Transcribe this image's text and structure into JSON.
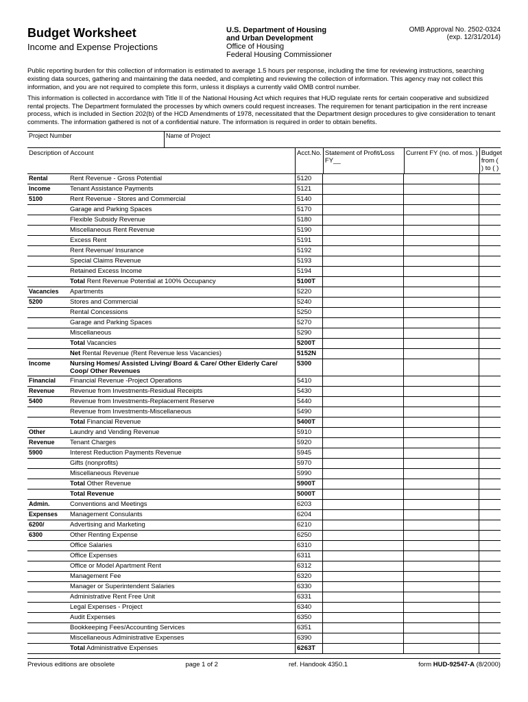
{
  "header": {
    "title": "Budget Worksheet",
    "subtitle": "Income and Expense Projections",
    "dept1": "U.S. Department of Housing",
    "dept2": "and Urban Development",
    "office1": "Office of Housing",
    "office2": "Federal Housing Commissioner",
    "omb1": "OMB Approval No. 2502-0324",
    "omb2": "(exp. 12/31/2014)"
  },
  "para1": "Public reporting burden for this collection of information is estimated to average 1.5 hours per response, including the time for reviewing instructions, searching existing data sources, gathering and maintaining the data needed, and completing and reviewing the collection of information.  This agency may not collect this information, and you are not required to complete this form, unless it displays a currently valid OMB control number.",
  "para2": "This information is collected in accordance with Title II of the National Housing Act which requires that HUD regulate rents for certain cooperative and subsidized rental projects.  The Department formulated the processes by which owners could request increases.  The requiremen for tenant participation in the rent increase process, which is included in Section 202(b) of the HCD Amendments of 1978, necessitated that the Department design procedures to give consideration to tenant comments.  The information gathered is not of a confidential nature.  The information is required in order to obtain benefits.",
  "proj": {
    "numLabel": "Project Number",
    "nameLabel": "Name of Project"
  },
  "columns": {
    "desc": "Description of Account",
    "acct": "Acct.No.",
    "stmt": "Statement of Profit/Loss FY__",
    "curr": "Current FY  (no. of mos.        )",
    "budg": "Budget from (           ) to (           )"
  },
  "sections": [
    {
      "cat": "Rental Income 5100",
      "rows": [
        {
          "d": "Rent Revenue - Gross Potential",
          "a": "5120"
        },
        {
          "d": "Tenant Assistance Payments",
          "a": "5121"
        },
        {
          "d": "Rent Revenue - Stores and Commercial",
          "a": "5140"
        },
        {
          "d": "Garage and Parking Spaces",
          "a": "5170"
        },
        {
          "d": "Flexible Subsidy Revenue",
          "a": "5180"
        },
        {
          "d": "Miscellaneous Rent Revenue",
          "a": "5190"
        },
        {
          "d": "Excess Rent",
          "a": "5191"
        },
        {
          "d": "Rent Revenue/ Insurance",
          "a": "5192"
        },
        {
          "d": "Special Claims Revenue",
          "a": "5193"
        },
        {
          "d": "Retained Excess Income",
          "a": "5194"
        },
        {
          "d": "Total Rent Revenue  Potential at 100% Occupancy",
          "a": "5100T",
          "bold": true,
          "boldPrefix": "Total",
          "rest": " Rent Revenue  Potential at 100% Occupancy"
        }
      ]
    },
    {
      "cat": "Vacancies 5200",
      "rows": [
        {
          "d": "Apartments",
          "a": "5220"
        },
        {
          "d": "Stores and Commercial",
          "a": "5240"
        },
        {
          "d": "Rental Concessions",
          "a": "5250"
        },
        {
          "d": "Garage and Parking Spaces",
          "a": "5270"
        },
        {
          "d": "Miscellaneous",
          "a": "5290"
        },
        {
          "d": "Total Vacancies",
          "a": "5200T",
          "bold": true,
          "boldPrefix": "Total",
          "rest": " Vacancies"
        },
        {
          "d": "Net Rental Revenue (Rent Revenue less Vacancies)",
          "a": "5152N",
          "bold": true,
          "boldPrefix": "Net",
          "rest": " Rental Revenue (Rent Revenue less Vacancies)"
        }
      ]
    },
    {
      "cat": "Income 5300",
      "rows": [
        {
          "d": "Nursing Homes/ Assisted Living/ Board & Care/ Other Elderly Care/ Coop/  Other Revenues",
          "a": "5300",
          "allBold": true
        }
      ]
    },
    {
      "cat": "Financial Revenue 5400",
      "rows": [
        {
          "d": "Financial Revenue -Project Operations",
          "a": "5410"
        },
        {
          "d": "Revenue from Investments-Residual Receipts",
          "a": "5430"
        },
        {
          "d": "Revenue from Investments-Replacement Reserve",
          "a": "5440"
        },
        {
          "d": "Revenue  from Investments-Miscellaneous",
          "a": "5490"
        },
        {
          "d": "Total Financial Revenue",
          "a": "5400T",
          "bold": true,
          "boldPrefix": "Total",
          "rest": " Financial Revenue"
        }
      ]
    },
    {
      "cat": "Other Revenue 5900",
      "rows": [
        {
          "d": "Laundry and Vending Revenue",
          "a": "5910"
        },
        {
          "d": "Tenant Charges",
          "a": "5920"
        },
        {
          "d": "Interest Reduction Payments Revenue",
          "a": "5945"
        },
        {
          "d": "Gifts (nonprofits)",
          "a": "5970"
        },
        {
          "d": "Miscellaneous Revenue",
          "a": "5990"
        },
        {
          "d": "Total Other Revenue",
          "a": "5900T",
          "bold": true,
          "boldPrefix": "Total",
          "rest": " Other Revenue"
        },
        {
          "d": "Total Revenue",
          "a": "5000T",
          "allBold": true
        }
      ]
    },
    {
      "cat": "Admin. Expenses 6200/ 6300",
      "rows": [
        {
          "d": "Conventions and Meetings",
          "a": "6203"
        },
        {
          "d": "Management Consulants",
          "a": "6204"
        },
        {
          "d": "Advertising and Marketing",
          "a": "6210"
        },
        {
          "d": "Other Renting Expense",
          "a": "6250"
        },
        {
          "d": "Office Salaries",
          "a": "6310"
        },
        {
          "d": "Office Expenses",
          "a": "6311"
        },
        {
          "d": "Office or Model Apartment Rent",
          "a": "6312"
        },
        {
          "d": "Management Fee",
          "a": "6320"
        },
        {
          "d": "Manager or Superintendent Salaries",
          "a": "6330"
        },
        {
          "d": "Administrative Rent Free Unit",
          "a": "6331"
        },
        {
          "d": "Legal Expenses - Project",
          "a": "6340"
        },
        {
          "d": "Audit Expenses",
          "a": "6350"
        },
        {
          "d": "Bookkeeping Fees/Accounting Services",
          "a": "6351"
        },
        {
          "d": "Miscellaneous Administrative Expenses",
          "a": "6390"
        },
        {
          "d": "Total Administrative Expenses",
          "a": "6263T",
          "bold": true,
          "boldPrefix": "Total",
          "rest": " Administrative Expenses"
        }
      ]
    }
  ],
  "footer": {
    "left": "Previous editions are obsolete",
    "center1": "page 1 of 2",
    "center2": "ref. Handook 4350.1",
    "right": "form  HUD-92547-A  (8/2000)"
  }
}
